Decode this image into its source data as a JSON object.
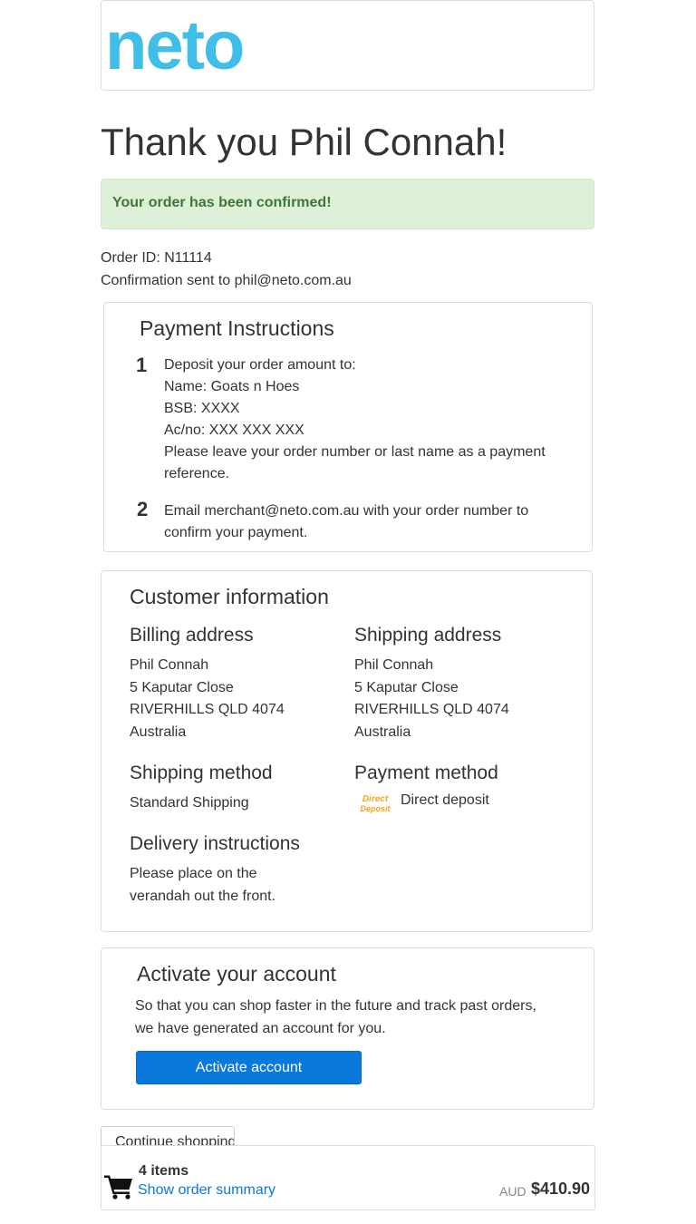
{
  "brand": {
    "logo_text": "neto",
    "logo_color": "#3fbee8"
  },
  "header": {
    "title": "Thank you Phil Connah!"
  },
  "alert": {
    "message": "Your order has been confirmed!"
  },
  "order": {
    "id_line": "Order ID: N11114",
    "confirmation_line": "Confirmation sent to phil@neto.com.au"
  },
  "payment_instructions": {
    "title": "Payment Instructions",
    "steps": [
      {
        "number": "1",
        "lines": [
          "Deposit your order amount to:",
          "Name: Goats n Hoes",
          "BSB: XXXX",
          "Ac/no: XXX XXX XXX",
          "Please leave your order number or last name as a payment",
          "reference."
        ]
      },
      {
        "number": "2",
        "lines": [
          "Email merchant@neto.com.au with your order number to",
          "confirm your payment."
        ]
      }
    ]
  },
  "customer_info": {
    "title": "Customer information",
    "billing": {
      "heading": "Billing address",
      "lines": [
        "Phil Connah",
        "5 Kaputar Close",
        "RIVERHILLS QLD 4074",
        "Australia"
      ]
    },
    "shipping": {
      "heading": "Shipping address",
      "lines": [
        "Phil Connah",
        "5 Kaputar Close",
        "RIVERHILLS QLD 4074",
        "Australia"
      ]
    },
    "shipping_method": {
      "heading": "Shipping method",
      "value": "Standard Shipping"
    },
    "payment_method": {
      "heading": "Payment method",
      "logo_line1": "Direct",
      "logo_line2": "Deposit",
      "value": "Direct deposit"
    },
    "delivery": {
      "heading": "Delivery instructions",
      "lines": [
        "Please place on the",
        "verandah out the front."
      ]
    }
  },
  "activate": {
    "title": "Activate your account",
    "lines": [
      "So that you can shop faster in the future and track past orders,",
      "we have generated an account for you."
    ],
    "button_label": "Activate account",
    "button_color": "#0b78dc"
  },
  "continue_button": {
    "label": "Continue shopping"
  },
  "cart_bar": {
    "icon": "shopping-cart-icon",
    "items_label": "4 items",
    "summary_link": "Show order summary",
    "currency": "AUD",
    "total": "$410.90"
  }
}
